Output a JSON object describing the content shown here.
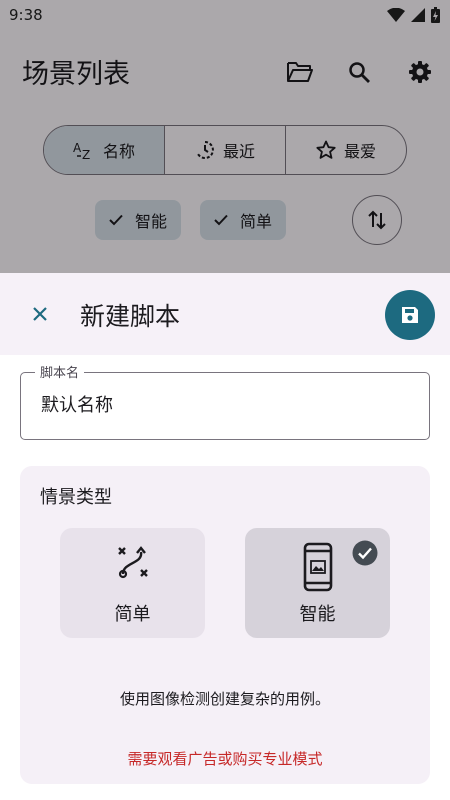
{
  "status_bar": {
    "time": "9:38"
  },
  "app_bar": {
    "title": "场景列表"
  },
  "sort_segments": [
    {
      "label": "名称",
      "icon": "sort-az-icon",
      "selected": true
    },
    {
      "label": "最近",
      "icon": "history-icon",
      "selected": false
    },
    {
      "label": "最爱",
      "icon": "star-icon",
      "selected": false
    }
  ],
  "filter_chips": [
    {
      "label": "智能",
      "checked": true
    },
    {
      "label": "简单",
      "checked": true
    }
  ],
  "sheet": {
    "title": "新建脚本",
    "name_field": {
      "label": "脚本名",
      "value": "默认名称"
    },
    "type_section": {
      "title": "情景类型",
      "options": [
        {
          "label": "简单",
          "icon": "route-icon",
          "selected": false
        },
        {
          "label": "智能",
          "icon": "smartphone-image-icon",
          "selected": true
        }
      ],
      "description": "使用图像检测创建复杂的用例。",
      "warning": "需要观看广告或购买专业模式"
    }
  },
  "colors": {
    "accent": "#1d6a80",
    "warning": "#c62828",
    "chip": "#d6dfe8"
  }
}
